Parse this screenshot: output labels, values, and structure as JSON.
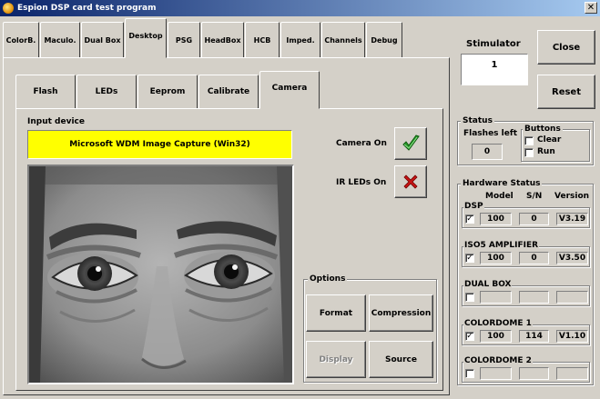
{
  "window": {
    "title": "Espion DSP card test program",
    "close_symbol": "✕"
  },
  "outer_tabs": [
    "ColorB.",
    "Maculo.",
    "Dual Box",
    "Desktop",
    "PSG",
    "HeadBox",
    "HCB",
    "Imped.",
    "Channels",
    "Debug"
  ],
  "outer_active": "Desktop",
  "inner_tabs": [
    "Flash",
    "LEDs",
    "Eeprom",
    "Calibrate",
    "Camera"
  ],
  "inner_active": "Camera",
  "camera": {
    "input_device_label": "Input device",
    "device_name": "Microsoft WDM Image Capture (Win32)",
    "camera_on_label": "Camera On",
    "camera_on_icon": "checkmark-icon",
    "ir_leds_label": "IR LEDs On",
    "ir_leds_icon": "cross-icon",
    "device_color": "#ffff00"
  },
  "options": {
    "title": "Options",
    "format": "Format",
    "compression": "Compression",
    "display": "Display",
    "source": "Source"
  },
  "stimulator": {
    "label": "Stimulator",
    "value": "1"
  },
  "buttons": {
    "close": "Close",
    "reset": "Reset"
  },
  "status": {
    "title": "Status",
    "flashes_left_label": "Flashes left",
    "flashes_left_value": "0",
    "buttons_title": "Buttons",
    "clear_label": "Clear",
    "run_label": "Run"
  },
  "hardware": {
    "title": "Hardware Status",
    "columns": [
      "Model",
      "S/N",
      "Version"
    ],
    "devices": [
      {
        "name": "DSP",
        "checked": true,
        "model": "100",
        "sn": "0",
        "version": "V3.19"
      },
      {
        "name": "ISO5 AMPLIFIER",
        "checked": true,
        "model": "100",
        "sn": "0",
        "version": "V3.50"
      },
      {
        "name": "DUAL BOX",
        "checked": false,
        "model": "",
        "sn": "",
        "version": ""
      },
      {
        "name": "COLORDOME 1",
        "checked": true,
        "model": "100",
        "sn": "114",
        "version": "V1.10"
      },
      {
        "name": "COLORDOME 2",
        "checked": false,
        "model": "",
        "sn": "",
        "version": ""
      }
    ]
  }
}
